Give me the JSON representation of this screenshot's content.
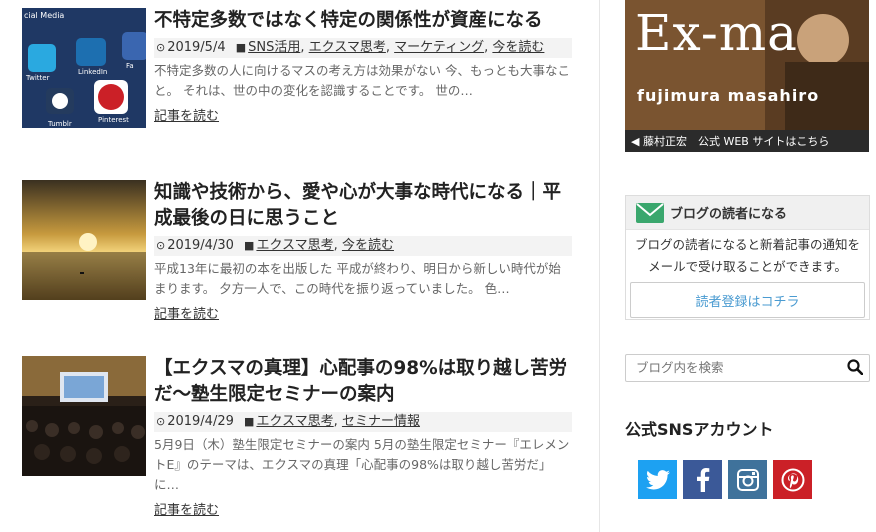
{
  "posts": [
    {
      "title": "不特定多数ではなく特定の関係性が資産になる",
      "date": "2019/5/4",
      "categories": [
        "SNS活用",
        "エクスマ思考",
        "マーケティング",
        "今を読む"
      ],
      "excerpt": "不特定多数の人に向けるマスの考え方は効果がない 今、もっとも大事なこと。 それは、世の中の変化を認識することです。 世の…",
      "more": "記事を読む",
      "thumb_labels": [
        "cial Media",
        "Twitter",
        "LinkedIn",
        "Fa",
        "Pinterest",
        "Tumblr"
      ]
    },
    {
      "title": "知識や技術から、愛や心が大事な時代になる｜平成最後の日に思うこと",
      "date": "2019/4/30",
      "categories": [
        "エクスマ思考",
        "今を読む"
      ],
      "excerpt": "平成13年に最初の本を出版した 平成が終わり、明日から新しい時代が始まります。 夕方一人で、この時代を振り返っていました。 色…",
      "more": "記事を読む"
    },
    {
      "title": "【エクスマの真理】心配事の98%は取り越し苦労だ〜塾生限定セミナーの案内",
      "date": "2019/4/29",
      "categories": [
        "エクスマ思考",
        "セミナー情報"
      ],
      "excerpt": "5月9日（木）塾生限定セミナーの案内 5月の塾生限定セミナー『エレメントE』のテーマは、エクスマの真理「心配事の98%は取り越し苦労だ」に…",
      "more": "記事を読む"
    }
  ],
  "sidebar": {
    "banner": {
      "logo": "Ex-ma",
      "name": "fujimura masahiro",
      "caption": "◀ 藤村正宏　公式 WEB サイトはこちら"
    },
    "reader": {
      "title": "ブログの読者になる",
      "text": "ブログの読者になると新着記事の通知をメールで受け取ることができます。",
      "button": "読者登録はコチラ"
    },
    "search": {
      "placeholder": "ブログ内を検索"
    },
    "sns": {
      "title": "公式SNSアカウント",
      "items": [
        {
          "icon": "twitter-icon",
          "color": "#1da1f2"
        },
        {
          "icon": "facebook-icon",
          "color": "#3b5998"
        },
        {
          "icon": "instagram-icon",
          "color": "#3f729b"
        },
        {
          "icon": "pinterest-icon",
          "color": "#cb2027"
        }
      ]
    }
  }
}
